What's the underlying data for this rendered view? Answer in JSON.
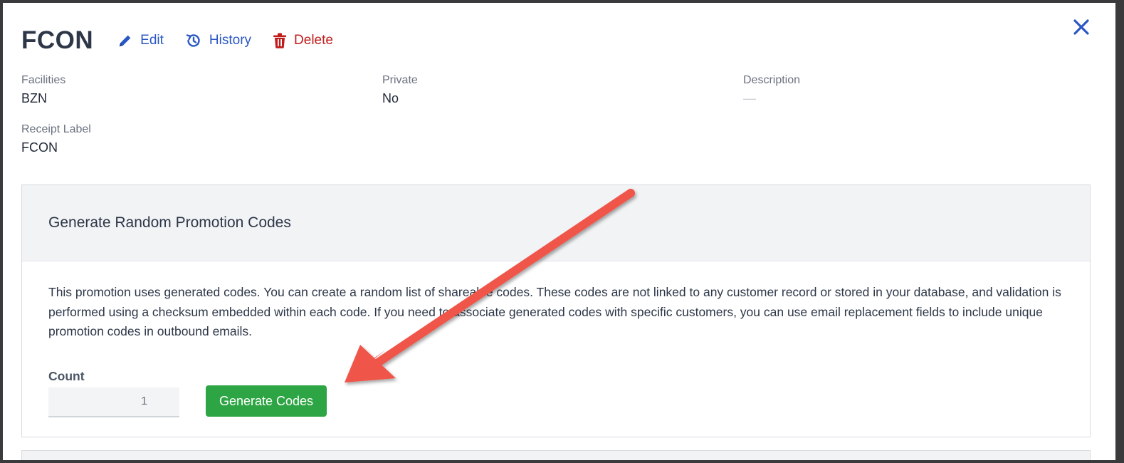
{
  "header": {
    "title": "FCON",
    "edit_label": "Edit",
    "history_label": "History",
    "delete_label": "Delete"
  },
  "fields": {
    "facilities": {
      "label": "Facilities",
      "value": "BZN"
    },
    "private": {
      "label": "Private",
      "value": "No"
    },
    "description": {
      "label": "Description",
      "value": "—"
    },
    "receipt_label": {
      "label": "Receipt Label",
      "value": "FCON"
    }
  },
  "generator": {
    "title": "Generate Random Promotion Codes",
    "description": "This promotion uses generated codes. You can create a random list of shareable codes. These codes are not linked to any customer record or stored in your database, and validation is performed using a checksum embedded within each code. If you need to associate generated codes with specific customers, you can use email replacement fields to include unique promotion codes in outbound emails.",
    "count_label": "Count",
    "count_value": "1",
    "button_label": "Generate Codes"
  },
  "colors": {
    "link_blue": "#2b57c4",
    "delete_red": "#c01c1c",
    "generate_green": "#2ea544",
    "annotation_arrow": "#f0554a"
  },
  "icons": [
    "pencil-icon",
    "history-icon",
    "trash-icon",
    "close-icon"
  ]
}
